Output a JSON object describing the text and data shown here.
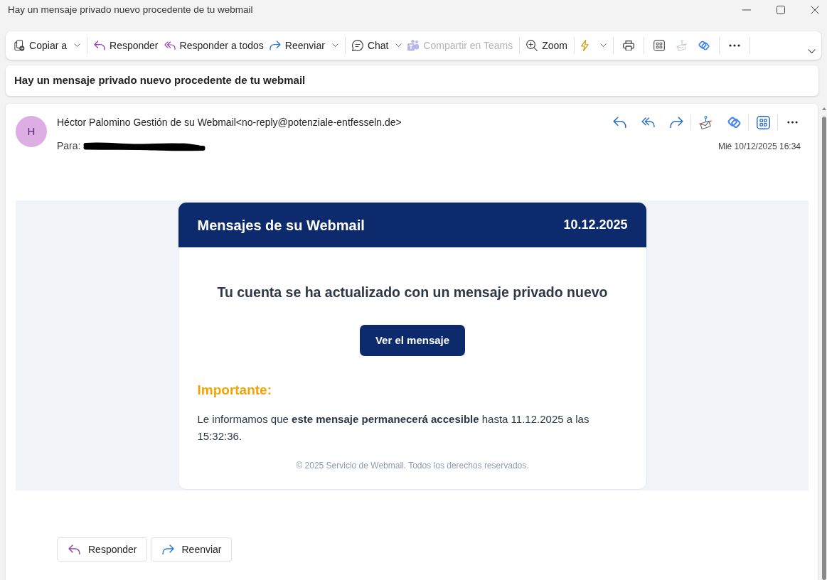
{
  "window": {
    "title": "Hay un mensaje privado nuevo procedente de tu webmail"
  },
  "toolbar": [
    {
      "kind": "copy",
      "label": "Copiar a",
      "dropdown": true,
      "disabled": false
    },
    {
      "kind": "separator"
    },
    {
      "kind": "reply",
      "label": "Responder",
      "dropdown": false,
      "disabled": false
    },
    {
      "kind": "reply-all",
      "label": "Responder a todos",
      "dropdown": false,
      "disabled": false
    },
    {
      "kind": "forward",
      "label": "Reenviar",
      "dropdown": true,
      "disabled": false
    },
    {
      "kind": "separator"
    },
    {
      "kind": "chat",
      "label": "Chat",
      "dropdown": true,
      "disabled": false
    },
    {
      "kind": "teams",
      "label": "Compartir en Teams",
      "dropdown": false,
      "disabled": true
    },
    {
      "kind": "separator"
    },
    {
      "kind": "zoom",
      "label": "Zoom",
      "dropdown": false,
      "disabled": false
    },
    {
      "kind": "separator"
    },
    {
      "kind": "bolt",
      "dropdown": true,
      "disabled": false
    },
    {
      "kind": "separator"
    },
    {
      "kind": "print",
      "dropdown": false,
      "disabled": false
    },
    {
      "kind": "separator"
    },
    {
      "kind": "apps",
      "dropdown": false,
      "disabled": false
    },
    {
      "kind": "envelope-pin",
      "dropdown": false,
      "disabled": true
    },
    {
      "kind": "linked-shapes",
      "dropdown": false,
      "disabled": false
    },
    {
      "kind": "separator"
    },
    {
      "kind": "more",
      "dropdown": false,
      "disabled": false
    },
    {
      "kind": "separator"
    }
  ],
  "subject": "Hay un mensaje privado nuevo procedente de tu webmail",
  "message": {
    "avatar": "H",
    "sender": "Héctor Palomino Gestión de su Webmail<no-reply@potenziale-entfesseln.de>",
    "to_label": "Para:",
    "recipient_redacted": true,
    "date": "Mié 10/12/2025 16:34",
    "actions": [
      {
        "kind": "reply"
      },
      {
        "kind": "reply-all"
      },
      {
        "kind": "forward"
      },
      {
        "kind": "separator"
      },
      {
        "kind": "envelope-pin"
      },
      {
        "kind": "linked-shapes"
      },
      {
        "kind": "separator"
      },
      {
        "kind": "apps"
      },
      {
        "kind": "separator"
      },
      {
        "kind": "more"
      }
    ]
  },
  "email": {
    "title": "Mensajes de su Webmail",
    "date": "10.12.2025",
    "heading": "Tu cuenta se ha actualizado con un mensaje privado nuevo",
    "button": "Ver el mensaje",
    "important": "Importante:",
    "notice": "Le informamos que **este mensaje permanecerá accesible** hasta 11.12.2025 a las 15:32:36.",
    "footer": "© 2025 Servicio de Webmail. Todos los derechos reservados."
  },
  "footer_actions": [
    {
      "kind": "reply",
      "label": "Responder"
    },
    {
      "kind": "forward",
      "label": "Reenviar"
    }
  ]
}
